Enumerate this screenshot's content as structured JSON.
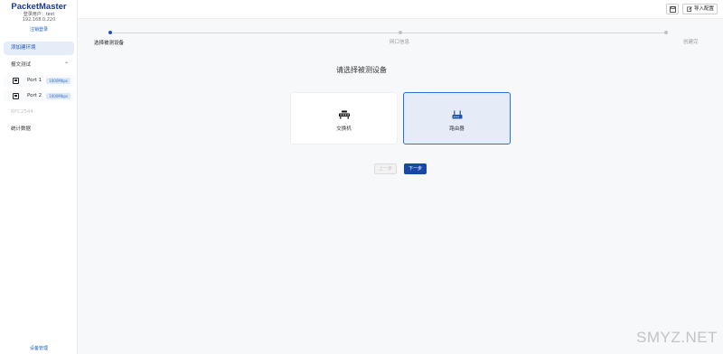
{
  "sidebar": {
    "brand": "PacketMaster",
    "login_user": "登录用户：test",
    "ip": "192.168.0.220",
    "logout": "注销登录",
    "add_stream": "添加建环境",
    "group": "报文测试",
    "ports": [
      {
        "label": "Port 1",
        "speed": "1000Mbps"
      },
      {
        "label": "Port 2",
        "speed": "1000Mbps"
      }
    ],
    "disabled_item": "RFC2544",
    "stats": "统计数据",
    "device_mgmt": "设备管理"
  },
  "topbar": {
    "save_icon": "save-icon",
    "import_label": "导入配置"
  },
  "steps": [
    {
      "label": "选择被测设备",
      "active": true
    },
    {
      "label": "网口信息",
      "active": false
    },
    {
      "label": "创建完",
      "active": false
    }
  ],
  "prompt": "请选择被测设备",
  "cards": {
    "switch": {
      "label": "交换机",
      "icon": "switch-icon"
    },
    "router": {
      "label": "路由器",
      "icon": "router-icon",
      "selected": true
    }
  },
  "buttons": {
    "prev": "上一步",
    "next": "下一步"
  },
  "colors": {
    "accent": "#1f55b0",
    "primary_button": "#1748a8",
    "selected_card_bg": "#e5ecf8"
  },
  "watermark": "SMYZ.NET"
}
